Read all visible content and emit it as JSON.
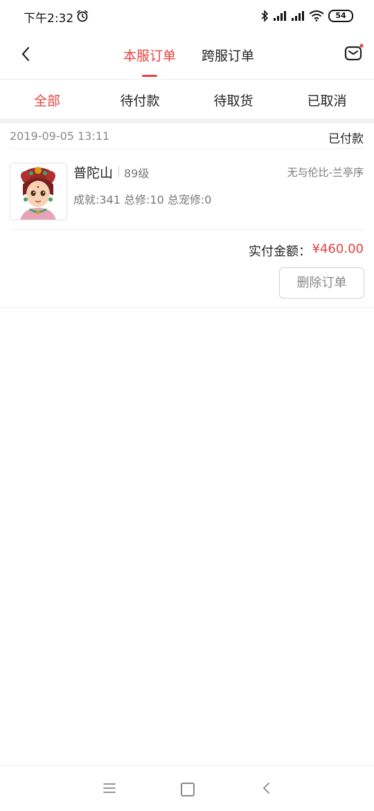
{
  "status_bar": {
    "time": "下午2:32",
    "battery": "54",
    "icons": [
      "alarm-icon",
      "bluetooth-icon",
      "signal-icon",
      "signal-icon",
      "wifi-icon",
      "battery-icon"
    ]
  },
  "header": {
    "tabs": [
      {
        "label": "本服订单",
        "active": true
      },
      {
        "label": "跨服订单",
        "active": false
      }
    ],
    "accent_color": "#e8413f"
  },
  "filters": [
    {
      "label": "全部",
      "active": true
    },
    {
      "label": "待付款",
      "active": false
    },
    {
      "label": "待取货",
      "active": false
    },
    {
      "label": "已取消",
      "active": false
    }
  ],
  "order": {
    "date": "2019-09-05 13:11",
    "status": "已付款",
    "item": {
      "name": "普陀山",
      "level": "89级",
      "server": "无与伦比-兰亭序",
      "stats": "成就:341 总修:10 总宠修:0"
    },
    "paid_label": "实付金额：",
    "paid_amount": "¥460.00",
    "delete_label": "删除订单"
  }
}
